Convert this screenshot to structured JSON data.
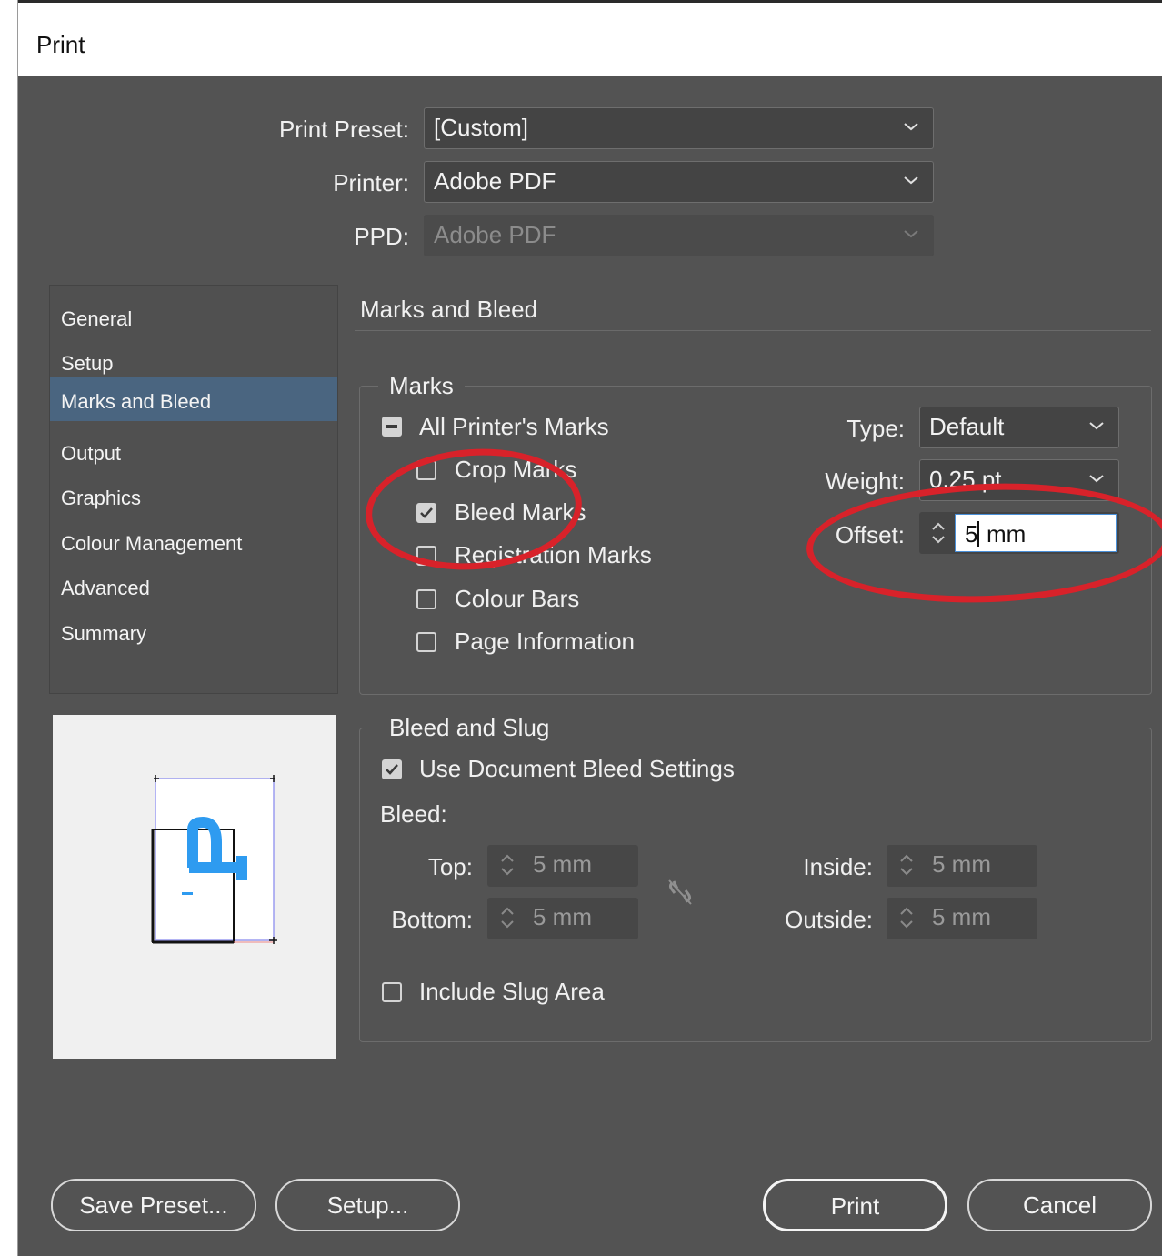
{
  "window": {
    "title": "Print"
  },
  "header": {
    "print_preset": {
      "label": "Print Preset:",
      "value": "[Custom]"
    },
    "printer": {
      "label": "Printer:",
      "value": "Adobe PDF"
    },
    "ppd": {
      "label": "PPD:",
      "value": "Adobe PDF"
    }
  },
  "sidebar": {
    "items": [
      {
        "label": "General"
      },
      {
        "label": "Setup"
      },
      {
        "label": "Marks and Bleed",
        "selected": true
      },
      {
        "label": "Output"
      },
      {
        "label": "Graphics"
      },
      {
        "label": "Colour Management"
      },
      {
        "label": "Advanced"
      },
      {
        "label": "Summary"
      }
    ]
  },
  "panel": {
    "title": "Marks and Bleed",
    "marks": {
      "group_title": "Marks",
      "all_printers_marks": {
        "label": "All Printer's Marks",
        "state": "mixed"
      },
      "crop_marks": {
        "label": "Crop Marks",
        "checked": false
      },
      "bleed_marks": {
        "label": "Bleed Marks",
        "checked": true
      },
      "registration_marks": {
        "label": "Registration Marks",
        "checked": false
      },
      "colour_bars": {
        "label": "Colour Bars",
        "checked": false
      },
      "page_information": {
        "label": "Page Information",
        "checked": false
      },
      "type": {
        "label": "Type:",
        "value": "Default"
      },
      "weight": {
        "label": "Weight:",
        "value": "0.25 pt"
      },
      "offset": {
        "label": "Offset:",
        "value": "5",
        "unit": "mm"
      }
    },
    "bleed_and_slug": {
      "group_title": "Bleed and Slug",
      "use_document_bleed": {
        "label": "Use Document Bleed Settings",
        "checked": true
      },
      "bleed_label": "Bleed:",
      "top": {
        "label": "Top:",
        "value": "5 mm"
      },
      "bottom": {
        "label": "Bottom:",
        "value": "5 mm"
      },
      "inside": {
        "label": "Inside:",
        "value": "5 mm"
      },
      "outside": {
        "label": "Outside:",
        "value": "5 mm"
      },
      "include_slug": {
        "label": "Include Slug Area",
        "checked": false
      }
    }
  },
  "buttons": {
    "save_preset": "Save Preset...",
    "setup": "Setup...",
    "print": "Print",
    "cancel": "Cancel"
  },
  "annotation": {
    "color": "#d8222a"
  },
  "colors": {
    "dialog_bg": "#535353",
    "selected_nav": "#4a6580",
    "preview_accent": "#2e9bf0"
  }
}
